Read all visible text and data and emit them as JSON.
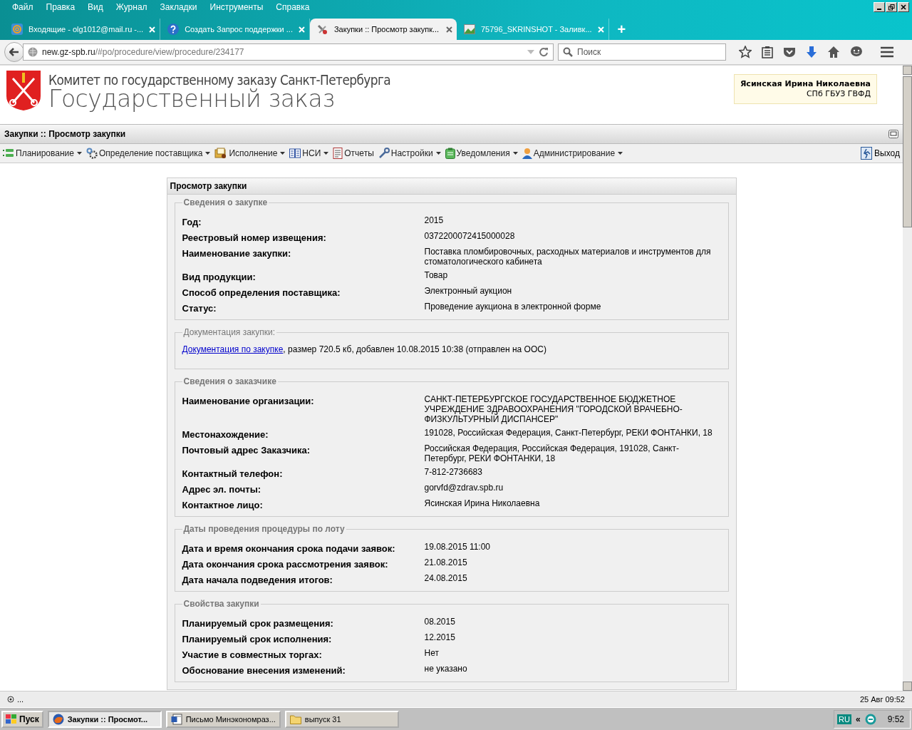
{
  "menu": [
    "Файл",
    "Правка",
    "Вид",
    "Журнал",
    "Закладки",
    "Инструменты",
    "Справка"
  ],
  "tabs": [
    {
      "label": "Входящие - olg1012@mail.ru -...",
      "selected": false,
      "kind": "mail"
    },
    {
      "label": "Создать Запрос поддержки ...",
      "selected": false,
      "kind": "help"
    },
    {
      "label": "Закупки :: Просмотр закупк...",
      "selected": true,
      "kind": "tools"
    },
    {
      "label": "75796_SKRINSHOT - Заливк...",
      "selected": false,
      "kind": "image"
    }
  ],
  "new_tab": "+",
  "address": {
    "host": "new.gz-spb.ru",
    "path": "/#po/procedure/view/procedure/234177"
  },
  "search": {
    "placeholder": "Поиск"
  },
  "header": {
    "committee": "Комитет по государственному заказу Санкт-Петербурга",
    "title": "Государственный заказ",
    "user_name": "Ясинская Ирина Николаевна",
    "user_org": "СПб ГБУЗ ГВФД"
  },
  "panel_title": "Закупки :: Просмотр закупки",
  "toolbar": [
    {
      "label": "Планирование",
      "kind": "plan",
      "dropdown": true
    },
    {
      "label": "Определение поставщика",
      "kind": "gears",
      "dropdown": true
    },
    {
      "label": "Исполнение",
      "kind": "exec",
      "dropdown": true
    },
    {
      "label": "НСИ",
      "kind": "book",
      "dropdown": true
    },
    {
      "label": "Отчеты",
      "kind": "report",
      "dropdown": false
    },
    {
      "label": "Настройки",
      "kind": "wrench",
      "dropdown": true
    },
    {
      "label": "Уведомления",
      "kind": "note",
      "dropdown": true
    },
    {
      "label": "Администрирование",
      "kind": "user",
      "dropdown": true
    }
  ],
  "logout": "Выход",
  "card_title": "Просмотр закупки",
  "sections": [
    {
      "title": "Сведения о закупке",
      "kind": "fields",
      "rows": [
        {
          "label": "Год:",
          "value": "2015"
        },
        {
          "label": "Реестровый номер извещения:",
          "value": "0372200072415000028"
        },
        {
          "label": "Наименование закупки:",
          "value": "Поставка пломбировочных, расходных материалов и инструментов для стоматологического кабинета"
        },
        {
          "label": "Вид продукции:",
          "value": "Товар"
        },
        {
          "label": "Способ определения поставщика:",
          "value": "Электронный аукцион"
        },
        {
          "label": "Статус:",
          "value": "Проведение аукциона в электронной форме"
        }
      ]
    },
    {
      "title": "Документация закупки:",
      "kind": "doc",
      "link": "Документация по закупке",
      "text": ", размер 720.5 кб, добавлен 10.08.2015 10:38 (отправлен на ООС)"
    },
    {
      "title": "Сведения о заказчике",
      "kind": "fields",
      "rows": [
        {
          "label": "Наименование организации:",
          "value": "САНКТ-ПЕТЕРБУРГСКОЕ ГОСУДАРСТВЕННОЕ БЮДЖЕТНОЕ УЧРЕЖДЕНИЕ ЗДРАВООХРАНЕНИЯ \"ГОРОДСКОЙ ВРАЧЕБНО-ФИЗКУЛЬТУРНЫЙ ДИСПАНСЕР\""
        },
        {
          "label": "Местонахождение:",
          "value": "191028, Российская Федерация, Санкт-Петербург, РЕКИ ФОНТАНКИ, 18"
        },
        {
          "label": "Почтовый адрес Заказчика:",
          "value": "Российская Федерация, Российская Федерация, 191028, Санкт-Петербург, РЕКИ ФОНТАНКИ, 18"
        },
        {
          "label": "Контактный телефон:",
          "value": "7-812-2736683"
        },
        {
          "label": "Адрес эл. почты:",
          "value": "gorvfd@zdrav.spb.ru"
        },
        {
          "label": "Контактное лицо:",
          "value": "Ясинская Ирина Николаевна"
        }
      ]
    },
    {
      "title": "Даты проведения процедуры по лоту",
      "kind": "fields",
      "rows": [
        {
          "label": "Дата и время окончания срока подачи заявок:",
          "value": "19.08.2015 11:00"
        },
        {
          "label": "Дата окончания срока рассмотрения заявок:",
          "value": "21.08.2015"
        },
        {
          "label": "Дата начала подведения итогов:",
          "value": "24.08.2015"
        }
      ]
    },
    {
      "title": "Свойства закупки",
      "kind": "fields",
      "rows": [
        {
          "label": "Планируемый срок размещения:",
          "value": "08.2015"
        },
        {
          "label": "Планируемый срок исполнения:",
          "value": "12.2015"
        },
        {
          "label": "Участие в совместных торгах:",
          "value": "Нет"
        },
        {
          "label": "Обоснование внесения изменений:",
          "value": "не указано"
        }
      ]
    }
  ],
  "status_bar": {
    "left": "...",
    "right": "25 Авг 09:52"
  },
  "taskbar": {
    "start": "Пуск",
    "tasks": [
      {
        "label": "Закупки :: Просмот...",
        "selected": true,
        "kind": "browser"
      },
      {
        "label": "Письмо Минэкономраз...",
        "selected": false,
        "kind": "doc"
      },
      {
        "label": "выпуск 31",
        "selected": false,
        "kind": "folder"
      }
    ],
    "lang": "RU",
    "tray_arrows": "«",
    "clock": "9:52"
  }
}
